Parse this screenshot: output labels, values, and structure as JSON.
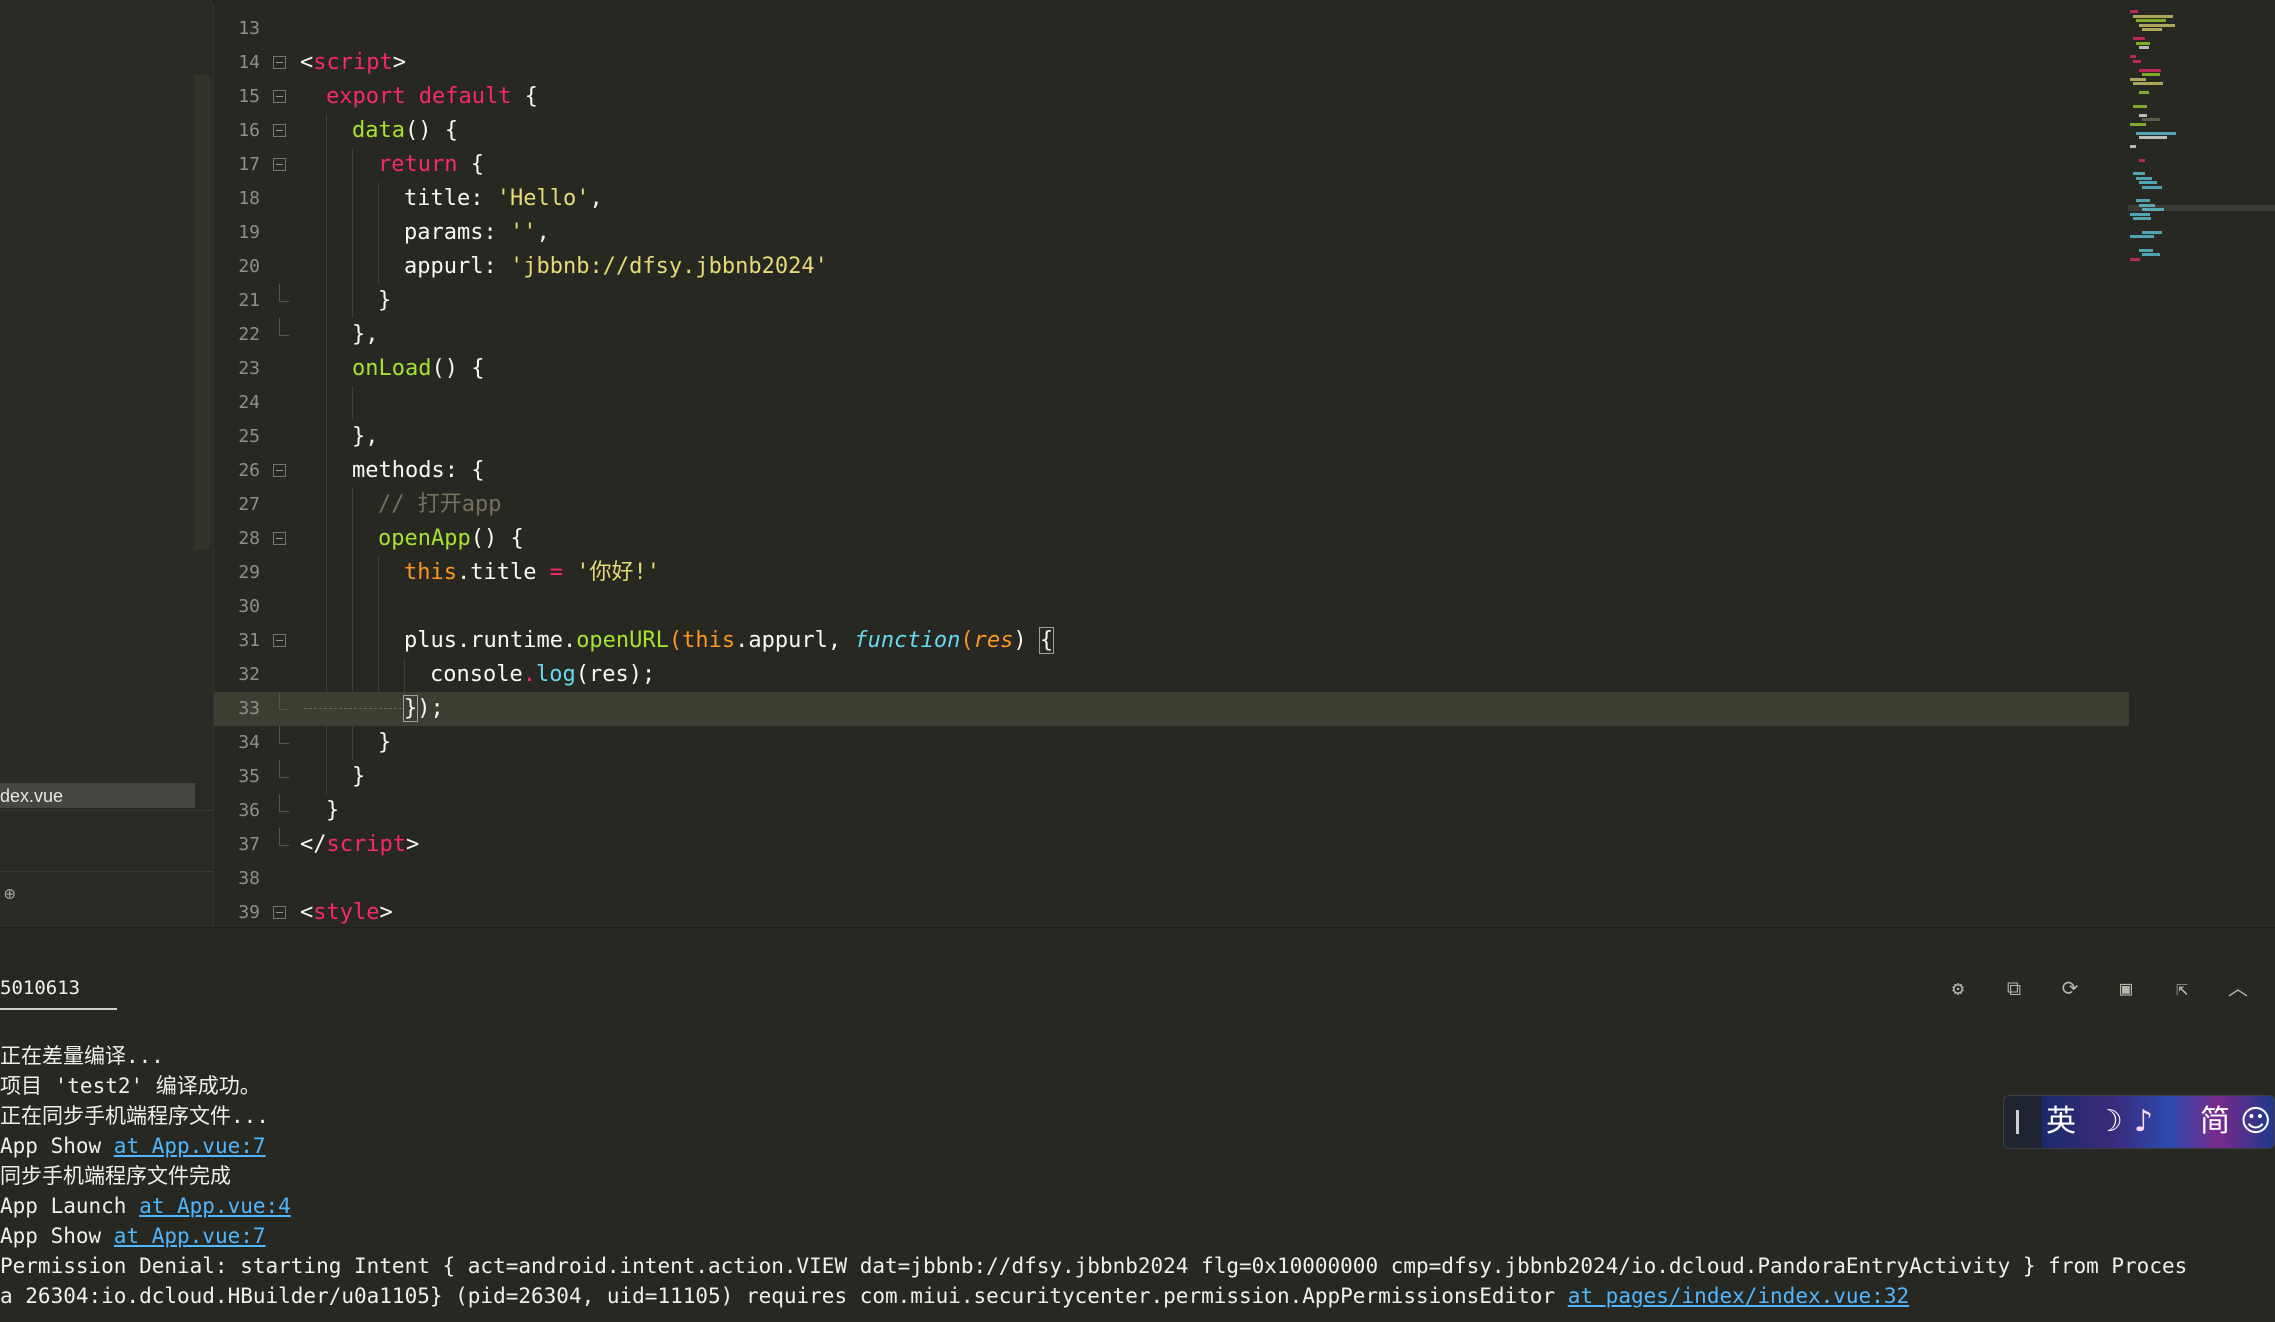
{
  "sidebar": {
    "file_label": "dex.vue",
    "globe_icon": "globe-icon"
  },
  "code_lines": [
    {
      "num": "13"
    },
    {
      "num": "14"
    },
    {
      "num": "15"
    },
    {
      "num": "16"
    },
    {
      "num": "17"
    },
    {
      "num": "18"
    },
    {
      "num": "19"
    },
    {
      "num": "20"
    },
    {
      "num": "21"
    },
    {
      "num": "22"
    },
    {
      "num": "23"
    },
    {
      "num": "24"
    },
    {
      "num": "25"
    },
    {
      "num": "26"
    },
    {
      "num": "27"
    },
    {
      "num": "28"
    },
    {
      "num": "29"
    },
    {
      "num": "30"
    },
    {
      "num": "31"
    },
    {
      "num": "32"
    },
    {
      "num": "33"
    },
    {
      "num": "34"
    },
    {
      "num": "35"
    },
    {
      "num": "36"
    },
    {
      "num": "37"
    },
    {
      "num": "38"
    },
    {
      "num": "39"
    }
  ],
  "code_text": {
    "l14": "<script>",
    "l15_k": "export default",
    "l15_r": " {",
    "l16_f": "data",
    "l16_r": "() {",
    "l17_k": "return",
    "l17_r": " {",
    "l18_a": "title: ",
    "l18_s": "'Hello'",
    "l18_r": ",",
    "l19_a": "params: ",
    "l19_s": "''",
    "l19_r": ",",
    "l20_a": "appurl: ",
    "l20_s": "'jbbnb://dfsy.jbbnb2024'",
    "l21": "}",
    "l22": "},",
    "l23_f": "onLoad",
    "l23_r": "() {",
    "l25": "},",
    "l26": "methods: {",
    "l27": "// 打开app",
    "l28_f": "openApp",
    "l28_r": "() {",
    "l29_t": "this",
    "l29_a": ".title ",
    "l29_o": "=",
    "l29_s": " '你好!'",
    "l31_a": "plus.runtime.",
    "l31_f": "openURL",
    "l31_p1": "(",
    "l31_t": "this",
    "l31_b": ".appurl, ",
    "l31_fn": "function",
    "l31_p2": "(",
    "l31_res": "res",
    "l31_p3": ") ",
    "l31_br": "{",
    "l32_a": "console",
    "l32_d": ".",
    "l32_m": "log",
    "l32_r": "(res);",
    "l33_br": "}",
    "l33_r": ");",
    "l34": "}",
    "l35": "}",
    "l36": "}",
    "l37_a": "</",
    "l37_k": "script",
    "l37_b": ">",
    "l39_a": "<",
    "l39_k": "style",
    "l39_b": ">"
  },
  "panel": {
    "tab_label": "5010613",
    "icons": [
      "bug-icon",
      "device-sync-icon",
      "restart-icon",
      "stop-icon",
      "export-icon",
      "collapse-up-icon"
    ],
    "console": {
      "l1": "正在差量编译...",
      "l2": "项目 'test2' 编译成功。",
      "l3": "正在同步手机端程序文件...",
      "l4_text": "App Show ",
      "l4_link": "at App.vue:7",
      "l5": "同步手机端程序文件完成",
      "l6_text": "App Launch ",
      "l6_link": "at App.vue:4",
      "l7_text": "App Show ",
      "l7_link": "at App.vue:7",
      "l8": "Permission Denial: starting Intent { act=android.intent.action.VIEW dat=jbbnb://dfsy.jbbnb2024 flg=0x10000000 cmp=dfsy.jbbnb2024/io.dcloud.PandoraEntryActivity } from Proces",
      "l9_text": "a 26304:io.dcloud.HBuilder/u0a1105} (pid=26304, uid=11105) requires com.miui.securitycenter.permission.AppPermissionsEditor ",
      "l9_link": "at pages/index/index.vue:32"
    }
  },
  "ime": {
    "lang": "英",
    "moon": "☽",
    "note": "♪",
    "mode": "简",
    "emoji": "☺"
  }
}
